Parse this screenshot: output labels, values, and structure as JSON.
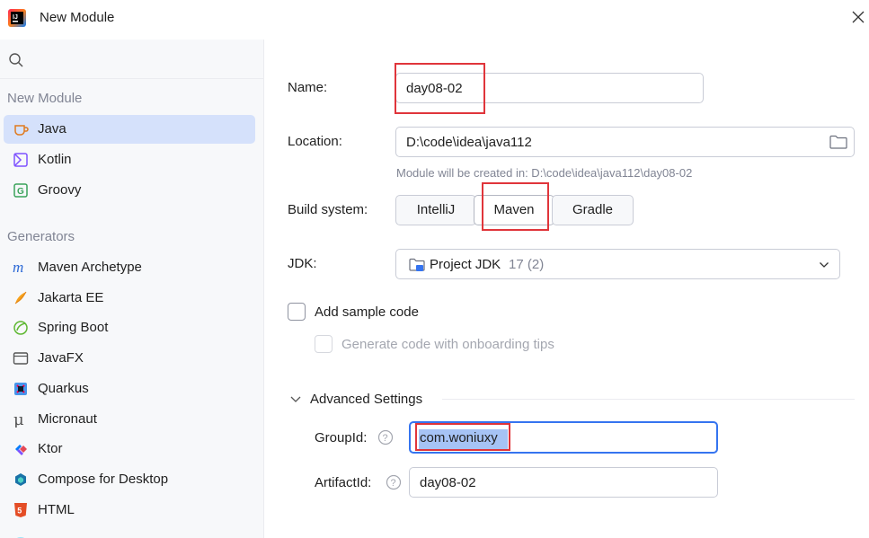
{
  "window": {
    "title": "New Module"
  },
  "sidebar": {
    "search_placeholder": "",
    "new_module_header": "New Module",
    "new_module_items": [
      {
        "label": "Java",
        "icon": "java-coffee-icon",
        "selected": true
      },
      {
        "label": "Kotlin",
        "icon": "kotlin-icon"
      },
      {
        "label": "Groovy",
        "icon": "groovy-icon"
      }
    ],
    "generators_header": "Generators",
    "generator_items": [
      {
        "label": "Maven Archetype",
        "icon": "maven-icon"
      },
      {
        "label": "Jakarta EE",
        "icon": "jakarta-ee-icon"
      },
      {
        "label": "Spring Boot",
        "icon": "spring-boot-icon"
      },
      {
        "label": "JavaFX",
        "icon": "javafx-icon"
      },
      {
        "label": "Quarkus",
        "icon": "quarkus-icon"
      },
      {
        "label": "Micronaut",
        "icon": "micronaut-icon"
      },
      {
        "label": "Ktor",
        "icon": "ktor-icon"
      },
      {
        "label": "Compose for Desktop",
        "icon": "compose-icon"
      },
      {
        "label": "HTML",
        "icon": "html5-icon"
      }
    ]
  },
  "form": {
    "name_label": "Name:",
    "name_value": "day08-02",
    "location_label": "Location:",
    "location_value": "D:\\code\\idea\\java112",
    "location_hint": "Module will be created in: D:\\code\\idea\\java112\\day08-02",
    "build_system_label": "Build system:",
    "build_options": [
      "IntelliJ",
      "Maven",
      "Gradle"
    ],
    "build_selected": "Maven",
    "jdk_label": "JDK:",
    "jdk_name": "Project JDK",
    "jdk_version": "17 (2)",
    "add_sample_code_label": "Add sample code",
    "add_sample_code_checked": false,
    "onboarding_tips_label": "Generate code with onboarding tips",
    "advanced_settings_label": "Advanced Settings",
    "groupid_label": "GroupId:",
    "groupid_value": "com.woniuxy",
    "artifactid_label": "ArtifactId:",
    "artifactid_value": "day08-02"
  },
  "colors": {
    "accent": "#3574f0",
    "selection": "#d5e1fb",
    "highlight_box": "#e0353b",
    "muted_text": "#818594"
  }
}
